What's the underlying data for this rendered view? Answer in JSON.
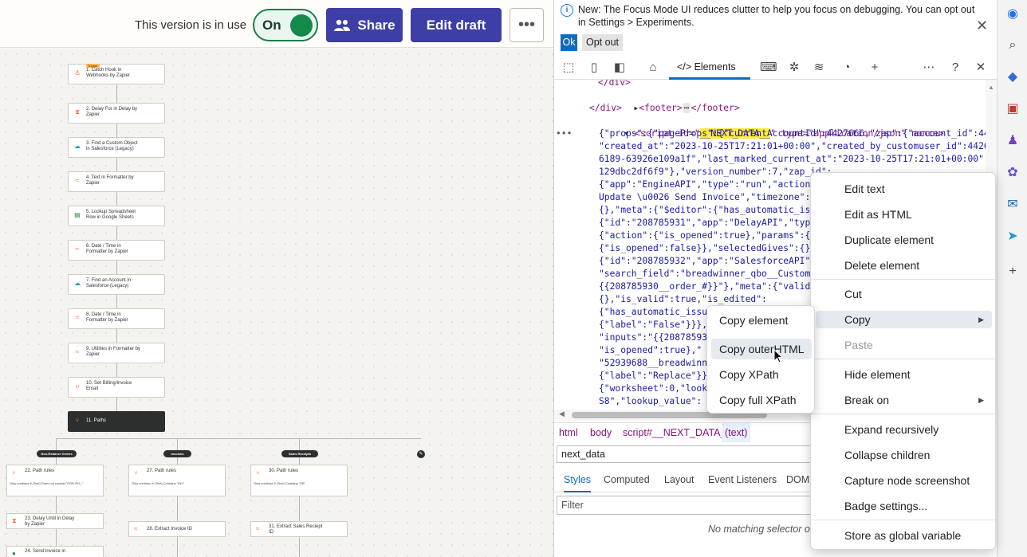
{
  "zap": {
    "version_text": "This version is in use",
    "toggle_label": "On",
    "share_label": "Share",
    "edit_draft_label": "Edit draft",
    "trigger_tag": "Trigger",
    "steps": [
      {
        "num": "1.",
        "line1": "Catch Hook in",
        "line2": "Webhooks by Zapier",
        "icon": "webhook-icon"
      },
      {
        "num": "2.",
        "line1": "Delay For in Delay by",
        "line2": "Zapier",
        "icon": "delay-icon"
      },
      {
        "num": "3.",
        "line1": "Find a Custom Object",
        "line2": "in Salesforce (Legacy)",
        "icon": "salesforce-icon"
      },
      {
        "num": "4.",
        "line1": "Text in Formatter by",
        "line2": "Zapier",
        "icon": "formatter-icon"
      },
      {
        "num": "5.",
        "line1": "Lookup Spreadsheet",
        "line2": "Row in Google Sheets",
        "icon": "sheets-icon"
      },
      {
        "num": "6.",
        "line1": "Date / Time in",
        "line2": "Formatter by Zapier",
        "icon": "formatter-icon"
      },
      {
        "num": "7.",
        "line1": "Find an Account in",
        "line2": "Salesforce (Legacy)",
        "icon": "salesforce-icon"
      },
      {
        "num": "8.",
        "line1": "Date / Time in",
        "line2": "Formatter by Zapier",
        "icon": "formatter-icon"
      },
      {
        "num": "9.",
        "line1": "Utilities in Formatter by",
        "line2": "Zapier",
        "icon": "formatter-icon"
      },
      {
        "num": "10.",
        "line1": "Set Billing/Invoice",
        "line2": "Email",
        "icon": "code-icon"
      },
      {
        "num": "11.",
        "line1": "Paths",
        "line2": "",
        "icon": "paths-icon"
      }
    ],
    "paths": [
      {
        "pill": "Non-Retainer Orders",
        "rule_title": "22. Path rules",
        "rule_detail": "Only continue if  (Text) Does not contain \"POR-RO_\"",
        "next": "23. Delay Until in Delay",
        "next2": "by Zapier",
        "next3": "24. Send Invoice in"
      },
      {
        "pill": "Invoices",
        "rule_title": "27. Path rules",
        "rule_detail": "Only continue if  (Text) Contains \"INV\"",
        "next": "28. Extract Invoice ID",
        "next2": "",
        "next3": ""
      },
      {
        "pill": "Sales Receipts",
        "rule_title": "30. Path rules",
        "rule_detail": "Only continue if  (Text) Contains \"SR\"",
        "next": "31. Extract Sales Reciept",
        "next2": "ID",
        "next3": ""
      }
    ]
  },
  "devtools": {
    "info_text": "New: The Focus Mode UI reduces clutter to help you focus on debugging. You can opt out in Settings > Experiments.",
    "ok_label": "Ok",
    "optout_label": "Opt out",
    "tab_elements": "Elements",
    "dom": {
      "l1": "</div>",
      "l2": "<footer>",
      "l2b": "</footer>",
      "l3": "</div>",
      "script_tag": "<script id=\"",
      "script_id_hl": "__NEXT_DATA__",
      "script_rest": "\" type=\"application/json\" nonce>",
      "json": [
        "{\"props\":{\"pageProps\":{\"currentAccountId\":4427666,\"zap\":{\"account_id\":442",
        "\"created_at\":\"2023-10-25T17:21:01+00:00\",\"created_by_customuser_id\":4426",
        "6189-63926e109a1f\",\"last_marked_current_at\":\"2023-10-25T17:21:01+00:00\",",
        "129dbc2df6f9\"},\"version_number\":7,\"zap_id\":",
        "{\"app\":\"EngineAPI\",\"type\":\"run\",\"action\"",
        "Update \\u0026 Send Invoice\",\"timezone\":",
        "{},\"meta\":{\"$editor\":{\"has_automatic_issu",
        "{\"id\":\"208785931\",\"app\":\"DelayAPI\",\"type\"",
        "{\"action\":{\"is_opened\":true},\"params\":{",
        "{\"is_opened\":false}},\"selectedGives\":{},",
        "{\"id\":\"208785932\",\"app\":\"SalesforceAPI\",",
        "\"search_field\":\"breadwinner_qbo__Custom_",
        "{{208785930__order_#}}\"},\"meta\":{\"valida",
        "{},\"is_valid\":true,\"is_edited\":",
        "{\"has_automatic_issue",
        "{\"label\":\"False\"}}},",
        "\"inputs\":\"{{20878593",
        "\"is_opened\":true},\"",
        "\"52939688__breadwinn",
        "{\"label\":\"Replace\"}}",
        "{\"worksheet\":0,\"looku",
        "S8\",\"lookup_value\":"
      ]
    },
    "breadcrumbs": [
      "html",
      "body",
      "script#__NEXT_DATA__",
      "(text)"
    ],
    "search_value": "next_data",
    "style_tabs": [
      "Styles",
      "Computed",
      "Layout",
      "Event Listeners",
      "DOM"
    ],
    "filter_placeholder": "Filter",
    "no_match": "No matching selector or"
  },
  "context_menu": {
    "items": [
      "Edit text",
      "Edit as HTML",
      "Duplicate element",
      "Delete element",
      "Cut",
      "Copy",
      "Paste",
      "Hide element",
      "Break on",
      "Expand recursively",
      "Collapse children",
      "Capture node screenshot",
      "Badge settings...",
      "Store as global variable"
    ]
  },
  "submenu": {
    "items": [
      "Copy element",
      "Copy outerHTML",
      "Copy XPath",
      "Copy full XPath"
    ]
  }
}
